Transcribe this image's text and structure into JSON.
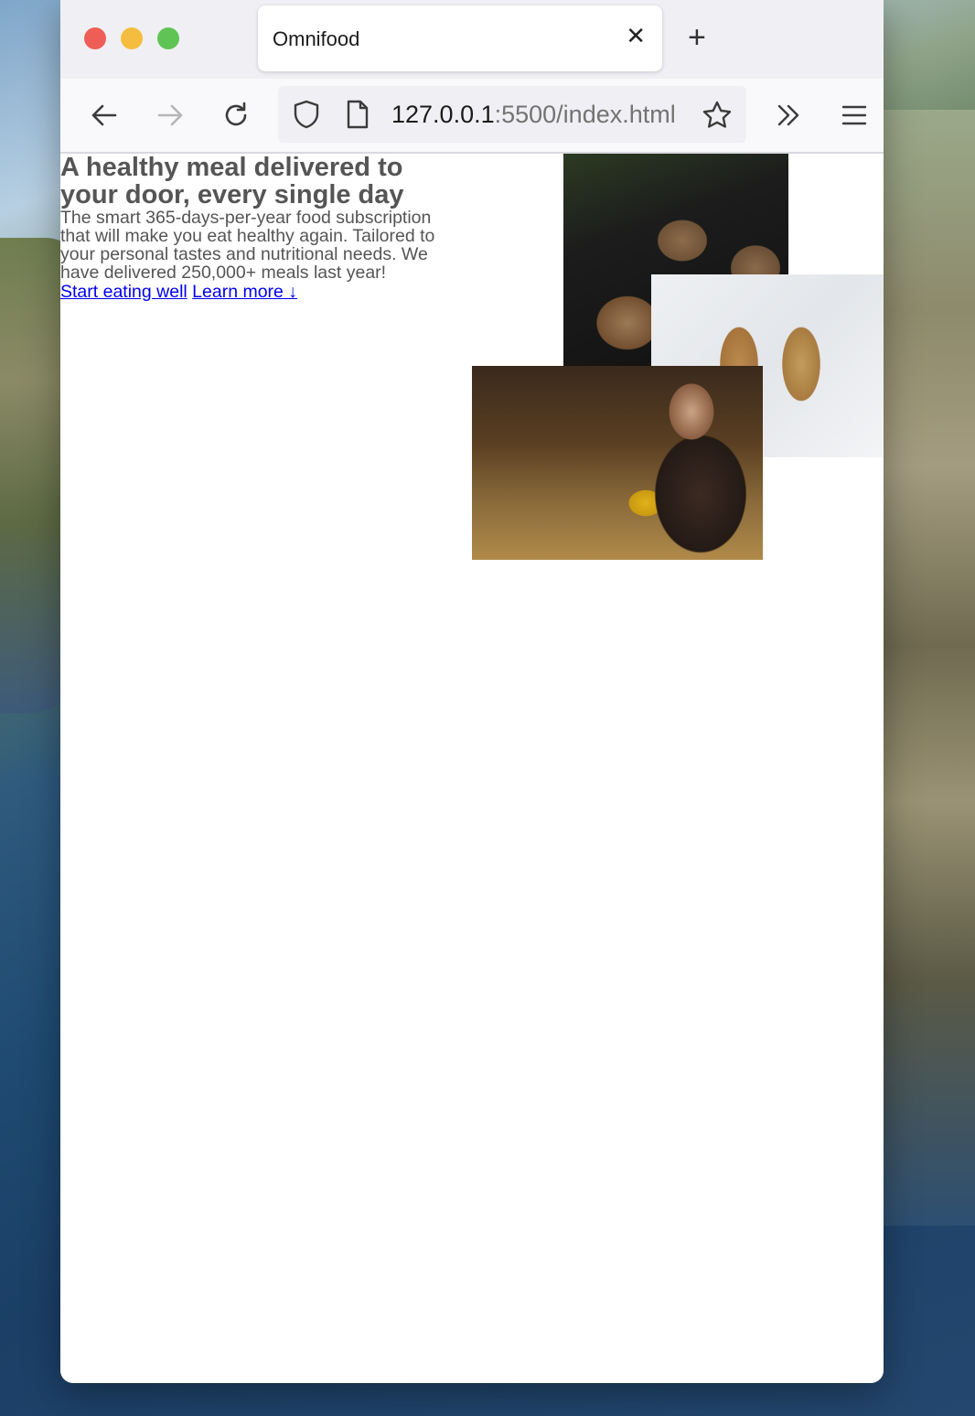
{
  "browser": {
    "tab_title": "Omnifood",
    "tab_close_glyph": "✕",
    "new_tab_glyph": "+",
    "url_host": "127.0.0.1",
    "url_rest": ":5500/index.html"
  },
  "hero": {
    "title": "A healthy meal delivered to your door, every single day",
    "description": "The smart 365-days-per-year food subscription that will make you eat healthy again. Tailored to your personal tastes and nutritional needs. We have delivered 250,000+ meals last year!",
    "cta_primary": "Start eating well",
    "cta_secondary": "Learn more ↓"
  },
  "icons": {
    "back": "arrow-left-icon",
    "forward": "arrow-right-icon",
    "reload": "reload-icon",
    "shield": "shield-icon",
    "page": "page-icon",
    "bookmark": "star-icon",
    "overflow": "chevron-double-right-icon",
    "menu": "hamburger-menu-icon"
  },
  "colors": {
    "link": "#0000ee",
    "text": "#555555",
    "traffic_red": "#ee5e57",
    "traffic_yellow": "#f5bd3f",
    "traffic_green": "#5fc454"
  }
}
